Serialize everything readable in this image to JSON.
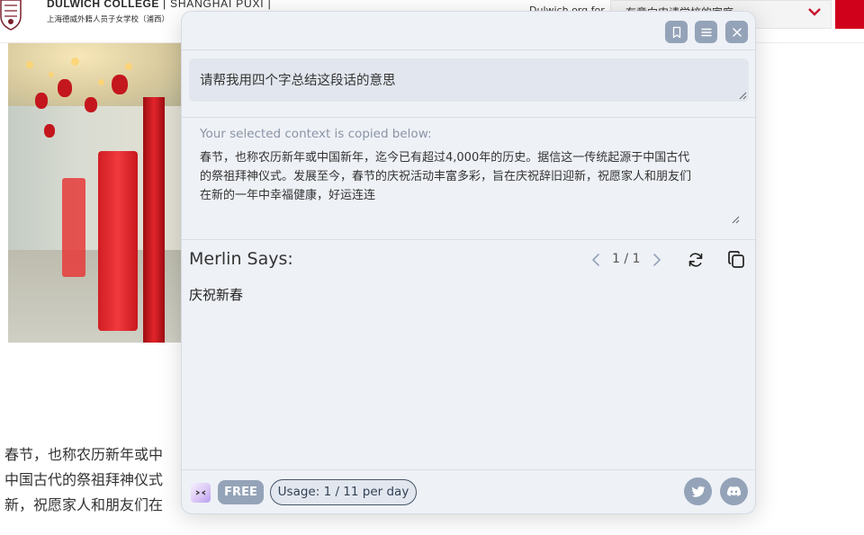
{
  "site": {
    "brand_main": "DULWICH COLLEGE",
    "brand_divider": " | ",
    "brand_light": "SHANGHAI PUXI |",
    "brand_sub": "上海德威外籍人员子女学校（浦西）",
    "header_link": "Dulwich.org for",
    "header_select": "有意向申请学校的家庭",
    "paragraph_lines": [
      "春节，也称农历新年或中",
      "中国古代的祭祖拜神仪式",
      "新，祝愿家人和朋友们在"
    ]
  },
  "panel": {
    "toolbar": {
      "bookmark_icon": "bookmark-icon",
      "menu_icon": "menu-icon",
      "close_icon": "close-icon"
    },
    "prompt": {
      "value": "请帮我用四个字总结这段话的意思"
    },
    "context": {
      "label": "Your selected context is copied below:",
      "lines": [
        "春节，也称农历新年或中国新年，迄今已有超过4,000年的历史。据信这一传统起源于中国古代",
        "的祭祖拜神仪式。发展至今，春节的庆祝活动丰富多彩，旨在庆祝辞旧迎新，祝愿家人和朋友们",
        "在新的一年中幸福健康，好运连连"
      ]
    },
    "response": {
      "heading": "Merlin Says:",
      "pager": "1 / 1",
      "answer": "庆祝新春"
    },
    "footer": {
      "plan_badge": "FREE",
      "usage": "Usage: 1 / 11 per day"
    },
    "colors": {
      "panel_bg": "#eef1f6",
      "button_bg": "#94a3b8",
      "input_bg": "#e2e7ef",
      "brand_red": "#d0021b"
    }
  }
}
